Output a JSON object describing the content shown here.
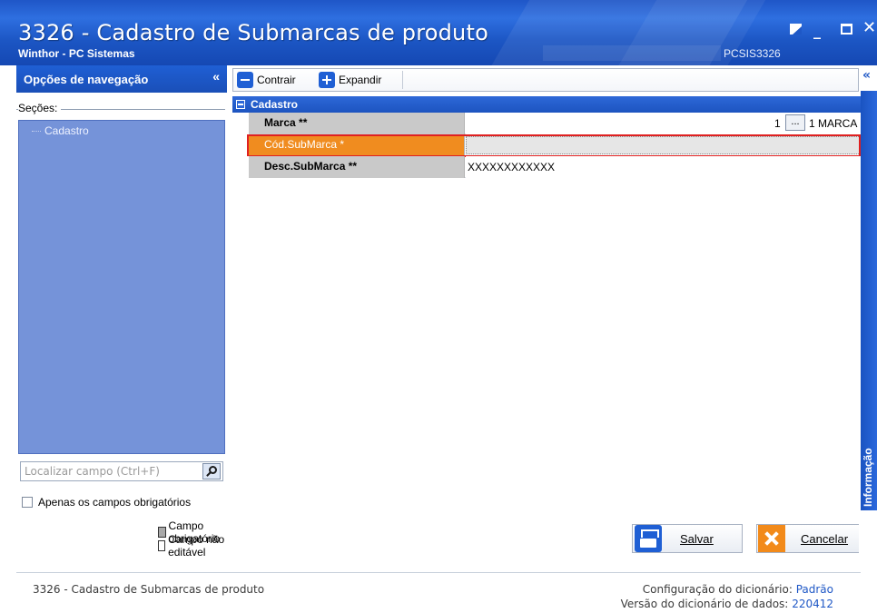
{
  "window": {
    "title": "3326 - Cadastro de Submarcas de produto",
    "subtitle": "Winthor - PC Sistemas",
    "program_code": "PCSIS3326",
    "controls": [
      "restore-icon",
      "minimize-icon",
      "maximize-icon",
      "close-icon"
    ]
  },
  "nav": {
    "header": "Opções de navegação",
    "collapse_glyph": "«",
    "sections_label": "Seções:",
    "sections": [
      "Cadastro"
    ]
  },
  "search": {
    "placeholder": "Localizar campo (Ctrl+F)",
    "icon": "magnifier-icon"
  },
  "filters": {
    "required_only_label": "Apenas os campos obrigatórios",
    "required_only_checked": false
  },
  "legend": {
    "required": "Campo obrigatório",
    "not_editable": "Campo não editável"
  },
  "toolbar": {
    "collapse_label": "Contrair",
    "expand_label": "Expandir"
  },
  "side_panel": {
    "collapse_glyph": "«",
    "info_label": "Informação"
  },
  "form": {
    "group_label": "Cadastro",
    "rows": [
      {
        "label": "Marca **",
        "code": "1",
        "lookup": "...",
        "value": "1 MARCA"
      },
      {
        "label": "Cód.SubMarca *",
        "value": ""
      },
      {
        "label": "Desc.SubMarca **",
        "value": "XXXXXXXXXXXX"
      }
    ]
  },
  "actions": {
    "save_label": "Salvar",
    "cancel_label": "Cancelar"
  },
  "status": {
    "left": "3326 - Cadastro de Submarcas de produto",
    "dict_config_label": "Configuração do dicionário:",
    "dict_config_value": "Padrão",
    "dict_version_label": "Versão do dicionário de dados:",
    "dict_version_value": "220412"
  },
  "colors": {
    "titlebar_blue": "#1f56c7",
    "section_list_blue": "#7593d9",
    "highlight_orange": "#f08c1f",
    "highlight_frame_red": "#e02020",
    "label_grey": "#c9c9c9"
  }
}
